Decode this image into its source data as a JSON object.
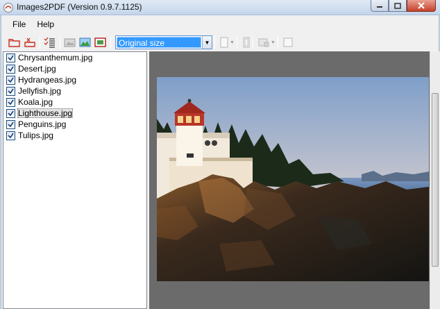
{
  "window": {
    "title": "Images2PDF (Version 0.9.7.1125)",
    "buttons": [
      "minimize",
      "maximize",
      "close"
    ]
  },
  "menu": [
    "File",
    "Help"
  ],
  "toolbar": {
    "icons": [
      "open-folder-icon",
      "remove-icon",
      "check-list-icon",
      "image-gray-icon",
      "image-landscape-icon",
      "image-red-icon"
    ],
    "size_select": {
      "value": "Original size"
    },
    "disabled_controls": [
      "page-color-dropdown",
      "page-orientation-button",
      "page-layout-dropdown",
      "extra-button"
    ]
  },
  "files": [
    {
      "name": "Chrysanthemum.jpg",
      "checked": true
    },
    {
      "name": "Desert.jpg",
      "checked": true
    },
    {
      "name": "Hydrangeas.jpg",
      "checked": true
    },
    {
      "name": "Jellyfish.jpg",
      "checked": true
    },
    {
      "name": "Koala.jpg",
      "checked": true
    },
    {
      "name": "Lighthouse.jpg",
      "checked": true,
      "selected": true
    },
    {
      "name": "Penguins.jpg",
      "checked": true
    },
    {
      "name": "Tulips.jpg",
      "checked": true
    }
  ],
  "colors": {
    "selection": "#3399ff",
    "preview_bg": "#6b6b6b",
    "title_bar": "#c4d5ea"
  }
}
